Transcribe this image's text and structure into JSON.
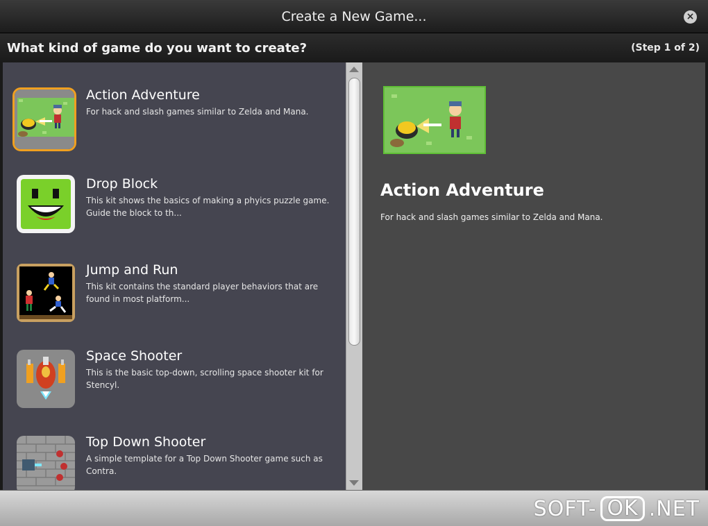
{
  "window": {
    "title": "Create a New Game...",
    "close_icon": "close-icon"
  },
  "question": {
    "text": "What kind of game do you want to create?",
    "step": "(Step 1 of 2)"
  },
  "kits": [
    {
      "name": "Action Adventure",
      "description": "For hack and slash games similar to Zelda and Mana.",
      "selected": true
    },
    {
      "name": "Drop Block",
      "description": "This kit shows the basics of making a phyics puzzle game. Guide the block to th...",
      "selected": false
    },
    {
      "name": "Jump and Run",
      "description": "This kit contains the standard player behaviors that are found in most platform...",
      "selected": false
    },
    {
      "name": "Space Shooter",
      "description": "This is the basic top-down, scrolling space shooter kit for Stencyl.",
      "selected": false
    },
    {
      "name": "Top Down Shooter",
      "description": "A simple template for a Top Down Shooter game such as Contra.",
      "selected": false
    }
  ],
  "preview": {
    "title": "Action Adventure",
    "description": "For hack and slash games similar to Zelda and Mana."
  },
  "watermark": {
    "left": "SOFT-",
    "box": "OK",
    "right": ".NET"
  },
  "colors": {
    "selected_border": "#f0a020",
    "list_bg": "#454550",
    "preview_bg": "#484848"
  }
}
